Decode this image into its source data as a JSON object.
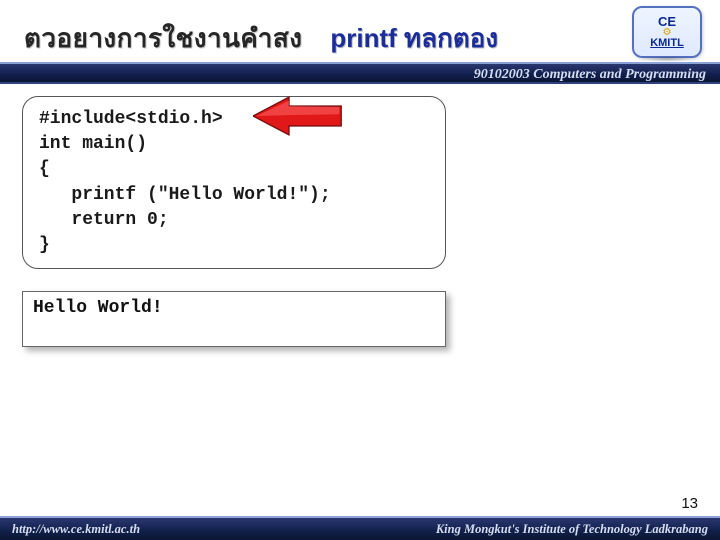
{
  "header": {
    "title_th": "ตวอยางการใชงานคำสง",
    "title_printf": "printf ทลกตอง",
    "logo_top": "CE",
    "logo_bottom": "KMITL",
    "bar_text": "90102003 Computers and Programming"
  },
  "code": {
    "source": "#include<stdio.h>\nint main()\n{\n   printf (\"Hello World!\");\n   return 0;\n}"
  },
  "output": {
    "text": "Hello World!"
  },
  "footer": {
    "left": "http://www.ce.kmitl.ac.th",
    "right": "King Mongkut's Institute of Technology Ladkrabang"
  },
  "page_number": "13"
}
